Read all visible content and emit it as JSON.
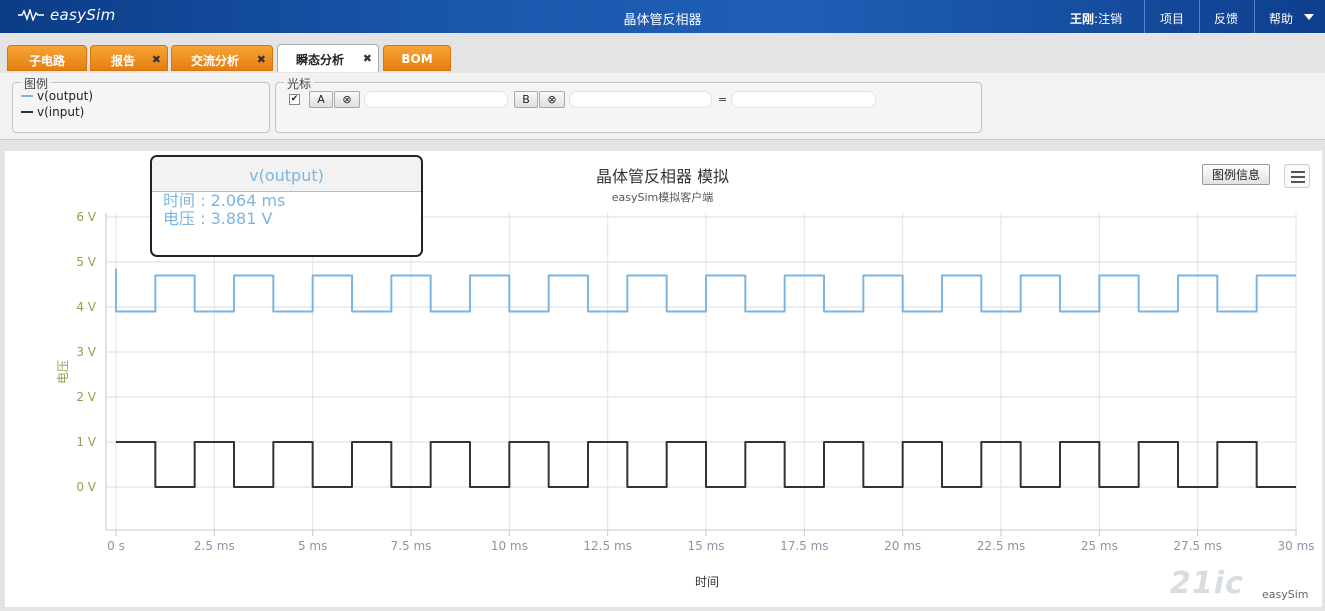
{
  "header": {
    "logo_text": "easySim",
    "title": "晶体管反相器",
    "user_name": "王刚",
    "logout": "注销",
    "nav": [
      "项目",
      "反馈",
      "帮助"
    ]
  },
  "tabs": [
    {
      "label": "子电路",
      "closable": false,
      "active": false
    },
    {
      "label": "报告",
      "closable": true,
      "active": false
    },
    {
      "label": "交流分析",
      "closable": true,
      "active": false
    },
    {
      "label": "瞬态分析",
      "closable": true,
      "active": true
    },
    {
      "label": "BOM",
      "closable": false,
      "active": false
    }
  ],
  "legend_panel": {
    "title": "图例",
    "items": [
      {
        "name": "v(output)",
        "color": "#7cb5e0"
      },
      {
        "name": "v(input)",
        "color": "#333333"
      }
    ]
  },
  "cursor_panel": {
    "title": "光标",
    "checkbox_checked": true,
    "button_a": "A",
    "button_b": "B",
    "clear_glyph": "⊗",
    "equals": "=",
    "value_a": "",
    "value_b": "",
    "value_diff": ""
  },
  "chart_toolbar": {
    "legend_info_button": "图例信息"
  },
  "tooltip": {
    "series": "v(output)",
    "time_label": "时间",
    "time_value": "2.064 ms",
    "voltage_label": "电压",
    "voltage_value": "3.881 V"
  },
  "watermark": {
    "text": "21ic",
    "sub": "easySim"
  },
  "chart_data": {
    "type": "line",
    "title": "晶体管反相器 模拟",
    "subtitle": "easySim模拟客户端",
    "xlabel": "时间",
    "ylabel": "电压",
    "xlim": [
      0,
      30
    ],
    "ylim": [
      -1,
      6.5
    ],
    "grid": true,
    "x_ticks": [
      "0 s",
      "2.5 ms",
      "5 ms",
      "7.5 ms",
      "10 ms",
      "12.5 ms",
      "15 ms",
      "17.5 ms",
      "20 ms",
      "22.5 ms",
      "25 ms",
      "27.5 ms",
      "30 ms"
    ],
    "y_ticks": [
      "0 V",
      "1 V",
      "2 V",
      "3 V",
      "4 V",
      "5 V",
      "6 V"
    ],
    "y_tick_values": [
      0,
      1,
      2,
      3,
      4,
      5,
      6
    ],
    "x_tick_values": [
      0,
      2.5,
      5,
      7.5,
      10,
      12.5,
      15,
      17.5,
      20,
      22.5,
      25,
      27.5,
      30
    ],
    "period_ms": 2,
    "high_duration_ms": 1,
    "series": [
      {
        "name": "v(input)",
        "color": "#333333",
        "low_v": 0,
        "high_v": 1,
        "start_level": "high",
        "start_time_ms": 0,
        "end_time_ms": 30
      },
      {
        "name": "v(output)",
        "color": "#7cb5e0",
        "low_v": 3.9,
        "high_v": 4.7,
        "start_level": "low",
        "start_time_ms": 0,
        "end_time_ms": 30,
        "start_spike_v": 4.85
      }
    ]
  }
}
